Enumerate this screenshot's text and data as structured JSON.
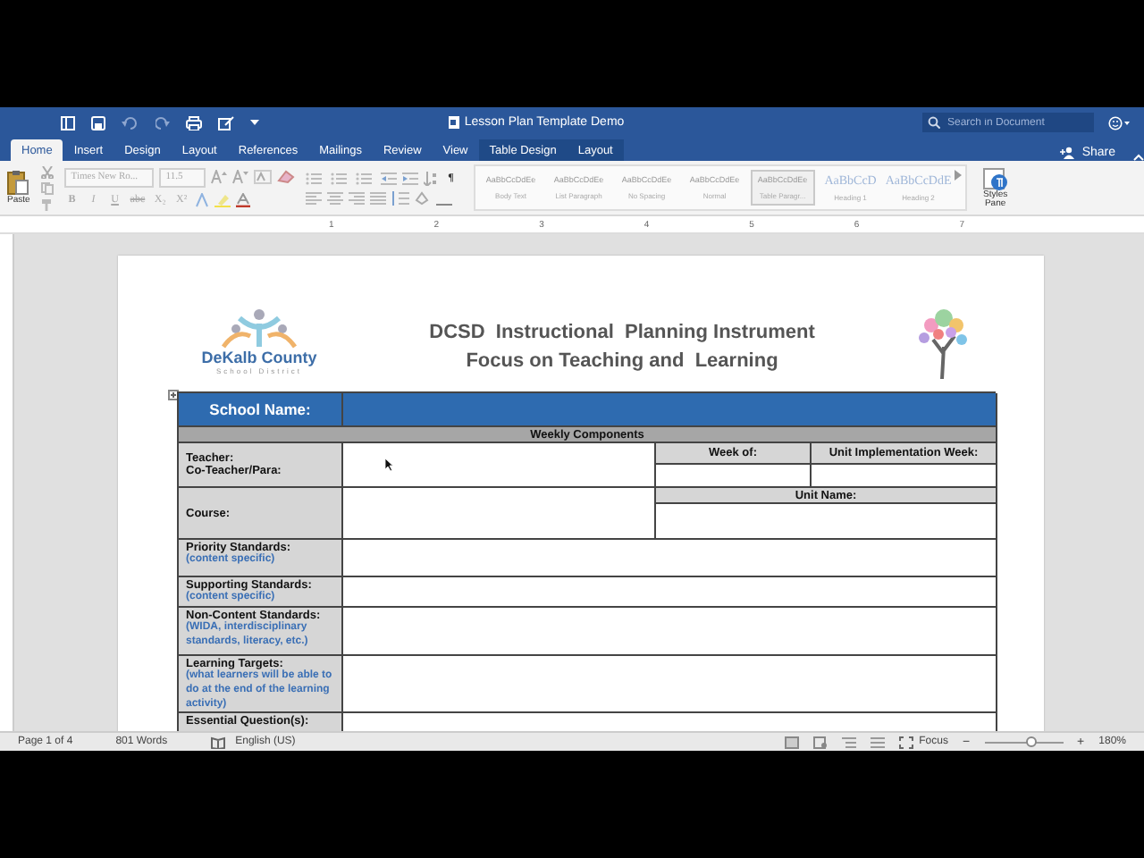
{
  "window": {
    "title": "Lesson Plan Template Demo"
  },
  "search": {
    "placeholder": "Search in Document"
  },
  "tabs": [
    {
      "label": "Home",
      "selected": true,
      "kind": "standard"
    },
    {
      "label": "Insert",
      "selected": false,
      "kind": "standard"
    },
    {
      "label": "Design",
      "selected": false,
      "kind": "standard"
    },
    {
      "label": "Layout",
      "selected": false,
      "kind": "standard"
    },
    {
      "label": "References",
      "selected": false,
      "kind": "standard"
    },
    {
      "label": "Mailings",
      "selected": false,
      "kind": "standard"
    },
    {
      "label": "Review",
      "selected": false,
      "kind": "standard"
    },
    {
      "label": "View",
      "selected": false,
      "kind": "standard"
    },
    {
      "label": "Table Design",
      "selected": false,
      "kind": "contextual"
    },
    {
      "label": "Layout",
      "selected": false,
      "kind": "contextual"
    }
  ],
  "share": "Share",
  "ribbon": {
    "paste": "Paste",
    "font": {
      "name": "Times New Ro...",
      "size": "11.5"
    },
    "format_buttons": [
      "B",
      "I",
      "U",
      "abc",
      "X₂",
      "X²"
    ],
    "pilcrow": "¶",
    "styles": [
      {
        "preview": "AaBbCcDdEe",
        "name": "Body Text",
        "selected": false,
        "kind": "body"
      },
      {
        "preview": "AaBbCcDdEe",
        "name": "List Paragraph",
        "selected": false,
        "kind": "body"
      },
      {
        "preview": "AaBbCcDdEe",
        "name": "No Spacing",
        "selected": false,
        "kind": "body"
      },
      {
        "preview": "AaBbCcDdEe",
        "name": "Normal",
        "selected": false,
        "kind": "body"
      },
      {
        "preview": "AaBbCcDdEe",
        "name": "Table Paragr...",
        "selected": true,
        "kind": "body"
      },
      {
        "preview": "AaBbCcD",
        "name": "Heading 1",
        "selected": false,
        "kind": "heading"
      },
      {
        "preview": "AaBbCcDdE",
        "name": "Heading 2",
        "selected": false,
        "kind": "heading"
      }
    ],
    "styles_pane": "Styles Pane"
  },
  "ruler": {
    "labels": [
      "1",
      "2",
      "3",
      "4",
      "5",
      "6",
      "7"
    ]
  },
  "document": {
    "logo": {
      "name": "DeKalb County",
      "subtitle": "School District"
    },
    "title_lines": [
      "DCSD  Instructional  Planning Instrument",
      "Focus on Teaching and  Learning"
    ],
    "table": {
      "school_name": "School Name:",
      "section": "Weekly Components",
      "teacher_labels": [
        "Teacher:",
        "Co-Teacher/Para:"
      ],
      "week_of": "Week of:",
      "unit_week": "Unit Implementation Week:",
      "course": "Course:",
      "unit_name": "Unit Name:",
      "fields": [
        {
          "label": "Priority Standards:",
          "hint": "(content specific)"
        },
        {
          "label": "Supporting Standards:",
          "hint": "(content specific)"
        },
        {
          "label": "Non-Content Standards:",
          "hint": "(WIDA, interdisciplinary standards, literacy, etc.)"
        },
        {
          "label": "Learning Targets:",
          "hint": "(what learners will be able to do at the end of the learning activity)"
        },
        {
          "label": "Essential Question(s):"
        }
      ]
    }
  },
  "status_bar": {
    "page": "Page 1 of 4",
    "words": "801 Words",
    "language": "English (US)",
    "focus": "Focus",
    "zoom_out": "−",
    "zoom_in": "+",
    "zoom": {
      "level": 0.6,
      "reading": "180%"
    }
  }
}
